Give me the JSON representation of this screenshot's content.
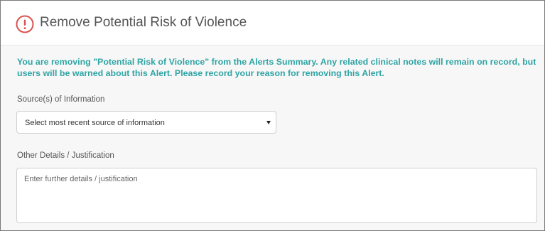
{
  "dialog": {
    "title": "Remove Potential Risk of Violence",
    "alert_icon": "exclamation-circle-icon",
    "accent_color": "#2fa4a4",
    "icon_color": "#d9534f"
  },
  "notice": {
    "text": "You are removing \"Potential Risk of Violence\" from the Alerts Summary. Any related clinical notes will remain on record, but users will be warned about this Alert. Please record your reason for removing this Alert."
  },
  "form": {
    "source_label": "Source(s) of Information",
    "source_select_value": "Select most recent source of information",
    "details_label": "Other Details / Justification",
    "details_placeholder": "Enter further details / justification"
  }
}
